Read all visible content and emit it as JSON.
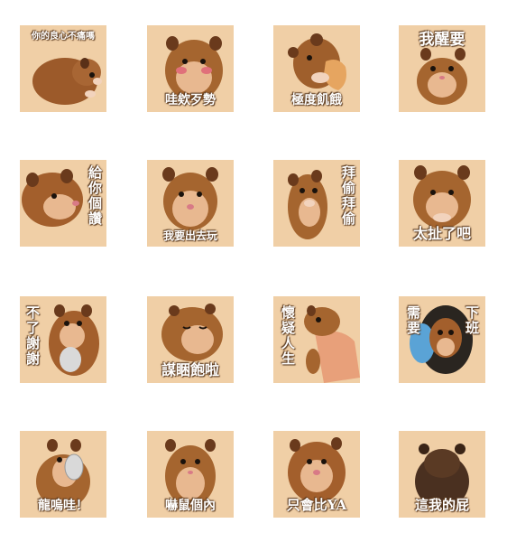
{
  "stickers": [
    {
      "caption": "你的良心不痛嗎"
    },
    {
      "caption": "哇欸歹勢"
    },
    {
      "caption": "極度飢餓"
    },
    {
      "caption": "我醒要"
    },
    {
      "caption": "給你個讚"
    },
    {
      "caption": "我要出去玩"
    },
    {
      "caption": "拜偷拜偷"
    },
    {
      "caption": "太扯了吧"
    },
    {
      "caption": "不了謝謝"
    },
    {
      "caption": "謀睏飽啦"
    },
    {
      "caption": "懷疑人生"
    },
    {
      "caption_a": "需要",
      "caption_b": "下班"
    },
    {
      "caption": "龍嗚哇！"
    },
    {
      "caption": "嚇鼠個內"
    },
    {
      "caption": "只會比YA"
    },
    {
      "caption": "這我的屁"
    }
  ]
}
